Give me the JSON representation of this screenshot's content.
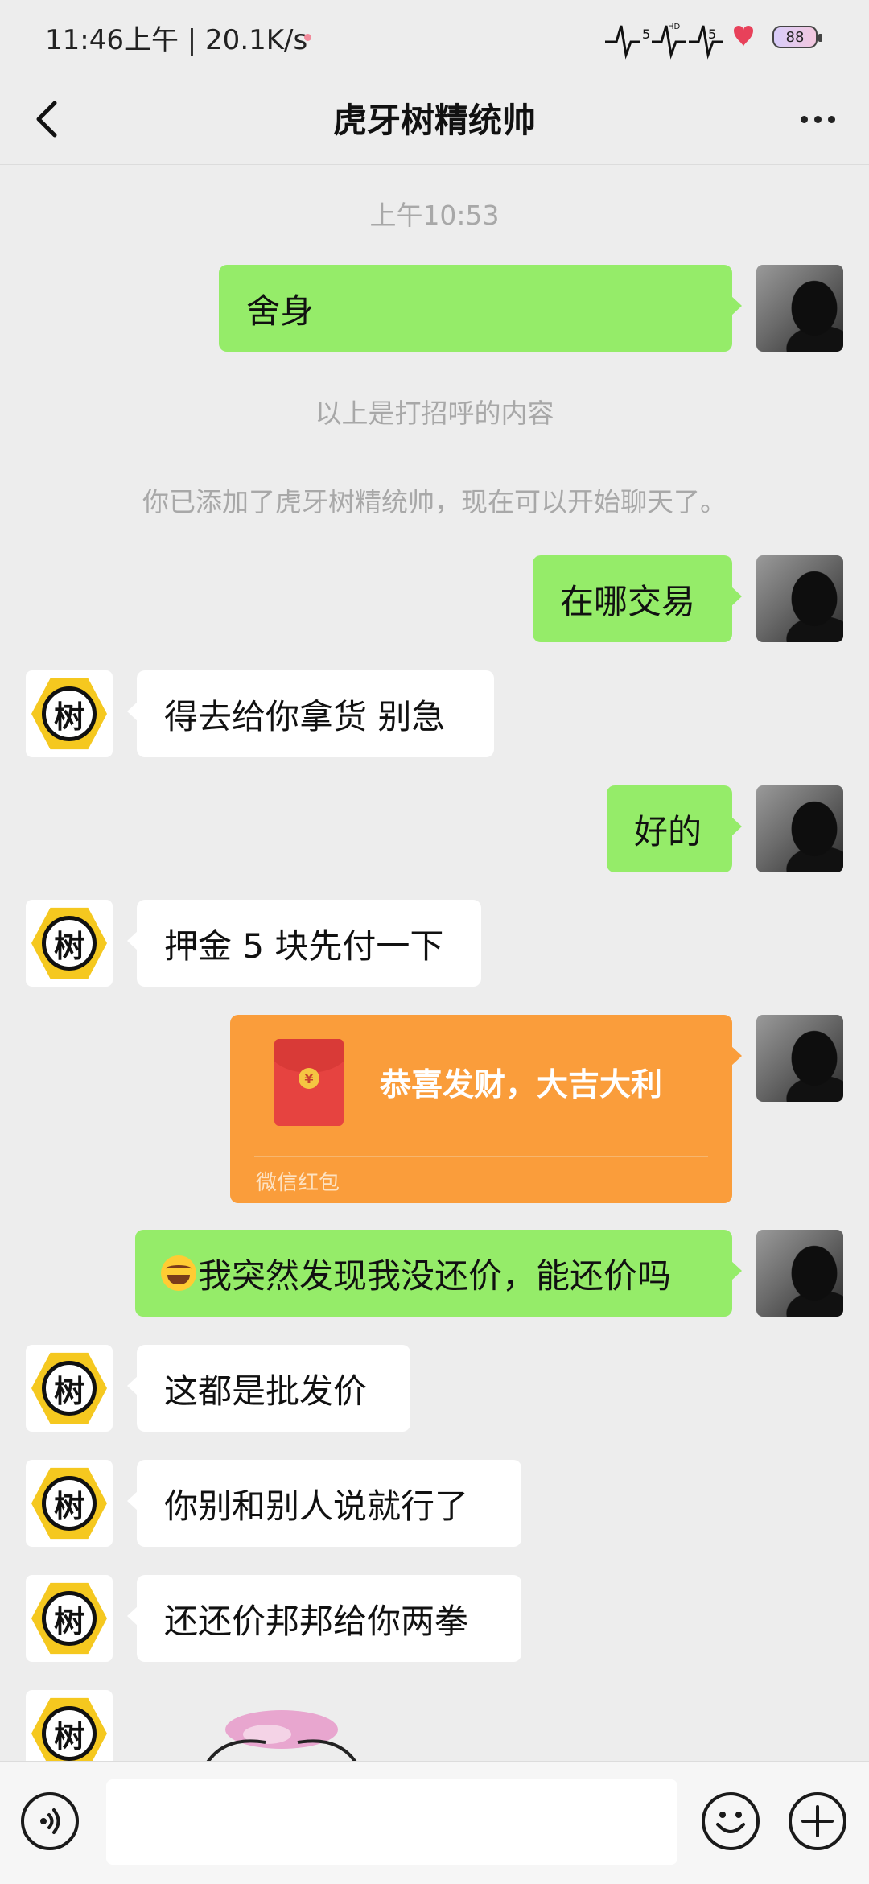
{
  "status_bar": {
    "time": "11:46上午 | 20.1K/s",
    "network_labels": [
      "5",
      "HD",
      "5"
    ],
    "battery": "88"
  },
  "header": {
    "title": "虎牙树精统帅"
  },
  "conversation": {
    "timestamp": "上午10:53",
    "system_greeting_note": "以上是打招呼的内容",
    "system_added_note": "你已添加了虎牙树精统帅，现在可以开始聊天了。",
    "contact_avatar_char": "树",
    "messages": [
      {
        "from": "me",
        "text": "舍身"
      },
      {
        "from": "me",
        "text": "在哪交易"
      },
      {
        "from": "them",
        "text": "得去给你拿货 别急"
      },
      {
        "from": "me",
        "text": "好的"
      },
      {
        "from": "them",
        "text": "押金 5 块先付一下"
      },
      {
        "from": "me",
        "type": "red_packet",
        "text": "恭喜发财，大吉大利",
        "footer": "微信红包",
        "icon_symbol": "¥"
      },
      {
        "from": "me",
        "emoji": "laughing-tears",
        "text": "我突然发现我没还价，能还价吗"
      },
      {
        "from": "them",
        "text": "这都是批发价"
      },
      {
        "from": "them",
        "text": "你别和别人说就行了"
      },
      {
        "from": "them",
        "text": "还还价邦邦给你两拳"
      },
      {
        "from": "them",
        "type": "sticker"
      }
    ]
  },
  "input_bar": {
    "value": "",
    "icons": [
      "voice-icon",
      "emoji-icon",
      "plus-icon"
    ]
  },
  "colors": {
    "background": "#ededed",
    "outgoing_bubble": "#95ec69",
    "incoming_bubble": "#ffffff",
    "red_packet": "#fa9d3b"
  }
}
